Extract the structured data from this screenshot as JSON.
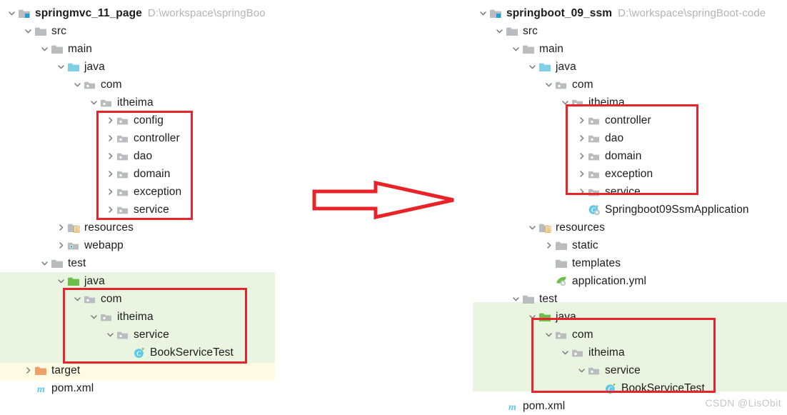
{
  "watermark": "CSDN @LisObit",
  "colors": {
    "annotation_red": "#e8242a",
    "highlight_green": "#e9f5e1",
    "highlight_yellow": "#fdfbe4",
    "folder_gray": "#b9bdc0",
    "folder_cyan": "#7ed0e8",
    "folder_green": "#6cbf4b",
    "folder_orange": "#f2a06a",
    "path_text_gray": "#b4b4b4"
  },
  "arrow": {
    "name": "transition-arrow",
    "direction": "right",
    "style": "outlined-block-arrow",
    "color": "#e8242a"
  },
  "left_tree": {
    "name": "springmvc-project-tree",
    "root_path": "D:\\workspace\\springBoo",
    "rows": [
      {
        "label": "springmvc_11_page",
        "indent": 0,
        "chevron": "down",
        "icon": "module-folder-icon",
        "root": true,
        "path": "D:\\workspace\\springBoo"
      },
      {
        "label": "src",
        "indent": 1,
        "chevron": "down",
        "icon": "folder-gray-icon"
      },
      {
        "label": "main",
        "indent": 2,
        "chevron": "down",
        "icon": "folder-gray-icon"
      },
      {
        "label": "java",
        "indent": 3,
        "chevron": "down",
        "icon": "folder-source-cyan-icon"
      },
      {
        "label": "com",
        "indent": 4,
        "chevron": "down",
        "icon": "package-icon"
      },
      {
        "label": "itheima",
        "indent": 5,
        "chevron": "down",
        "icon": "package-icon"
      },
      {
        "label": "config",
        "indent": 6,
        "chevron": "right",
        "icon": "package-icon"
      },
      {
        "label": "controller",
        "indent": 6,
        "chevron": "right",
        "icon": "package-icon"
      },
      {
        "label": "dao",
        "indent": 6,
        "chevron": "right",
        "icon": "package-icon"
      },
      {
        "label": "domain",
        "indent": 6,
        "chevron": "right",
        "icon": "package-icon"
      },
      {
        "label": "exception",
        "indent": 6,
        "chevron": "right",
        "icon": "package-icon"
      },
      {
        "label": "service",
        "indent": 6,
        "chevron": "right",
        "icon": "package-icon"
      },
      {
        "label": "resources",
        "indent": 3,
        "chevron": "right",
        "icon": "resources-folder-icon"
      },
      {
        "label": "webapp",
        "indent": 3,
        "chevron": "right",
        "icon": "webapp-folder-icon"
      },
      {
        "label": "test",
        "indent": 2,
        "chevron": "down",
        "icon": "folder-gray-icon"
      },
      {
        "label": "java",
        "indent": 3,
        "chevron": "down",
        "icon": "folder-test-green-icon"
      },
      {
        "label": "com",
        "indent": 4,
        "chevron": "down",
        "icon": "package-icon"
      },
      {
        "label": "itheima",
        "indent": 5,
        "chevron": "down",
        "icon": "package-icon"
      },
      {
        "label": "service",
        "indent": 6,
        "chevron": "down",
        "icon": "package-icon"
      },
      {
        "label": "BookServiceTest",
        "indent": 7,
        "chevron": "none",
        "icon": "java-class-test-icon"
      },
      {
        "label": "target",
        "indent": 1,
        "chevron": "right",
        "icon": "folder-orange-icon"
      },
      {
        "label": "pom.xml",
        "indent": 1,
        "chevron": "none",
        "icon": "maven-pom-icon"
      }
    ]
  },
  "right_tree": {
    "name": "springboot-project-tree",
    "root_path": "D:\\workspace\\springBoot-code",
    "rows": [
      {
        "label": "springboot_09_ssm",
        "indent": 0,
        "chevron": "down",
        "icon": "module-folder-icon",
        "root": true,
        "path": "D:\\workspace\\springBoot-code"
      },
      {
        "label": "src",
        "indent": 1,
        "chevron": "down",
        "icon": "folder-gray-icon"
      },
      {
        "label": "main",
        "indent": 2,
        "chevron": "down",
        "icon": "folder-gray-icon"
      },
      {
        "label": "java",
        "indent": 3,
        "chevron": "down",
        "icon": "folder-source-cyan-icon"
      },
      {
        "label": "com",
        "indent": 4,
        "chevron": "down",
        "icon": "package-icon"
      },
      {
        "label": "itheima",
        "indent": 5,
        "chevron": "down",
        "icon": "package-icon"
      },
      {
        "label": "controller",
        "indent": 6,
        "chevron": "right",
        "icon": "package-icon"
      },
      {
        "label": "dao",
        "indent": 6,
        "chevron": "right",
        "icon": "package-icon"
      },
      {
        "label": "domain",
        "indent": 6,
        "chevron": "right",
        "icon": "package-icon"
      },
      {
        "label": "exception",
        "indent": 6,
        "chevron": "right",
        "icon": "package-icon"
      },
      {
        "label": "service",
        "indent": 6,
        "chevron": "right",
        "icon": "package-icon"
      },
      {
        "label": "Springboot09SsmApplication",
        "indent": 6,
        "chevron": "none",
        "icon": "spring-boot-class-icon"
      },
      {
        "label": "resources",
        "indent": 3,
        "chevron": "down",
        "icon": "resources-folder-icon"
      },
      {
        "label": "static",
        "indent": 4,
        "chevron": "right",
        "icon": "folder-gray-icon"
      },
      {
        "label": "templates",
        "indent": 4,
        "chevron": "none",
        "icon": "folder-gray-icon"
      },
      {
        "label": "application.yml",
        "indent": 4,
        "chevron": "none",
        "icon": "spring-yml-icon"
      },
      {
        "label": "test",
        "indent": 2,
        "chevron": "down",
        "icon": "folder-gray-icon"
      },
      {
        "label": "java",
        "indent": 3,
        "chevron": "down",
        "icon": "folder-test-green-icon"
      },
      {
        "label": "com",
        "indent": 4,
        "chevron": "down",
        "icon": "package-icon"
      },
      {
        "label": "itheima",
        "indent": 5,
        "chevron": "down",
        "icon": "package-icon"
      },
      {
        "label": "service",
        "indent": 6,
        "chevron": "down",
        "icon": "package-icon"
      },
      {
        "label": "BookServiceTest",
        "indent": 7,
        "chevron": "none",
        "icon": "java-class-test-icon"
      },
      {
        "label": "pom.xml",
        "indent": 1,
        "chevron": "none",
        "icon": "maven-pom-icon"
      }
    ]
  }
}
